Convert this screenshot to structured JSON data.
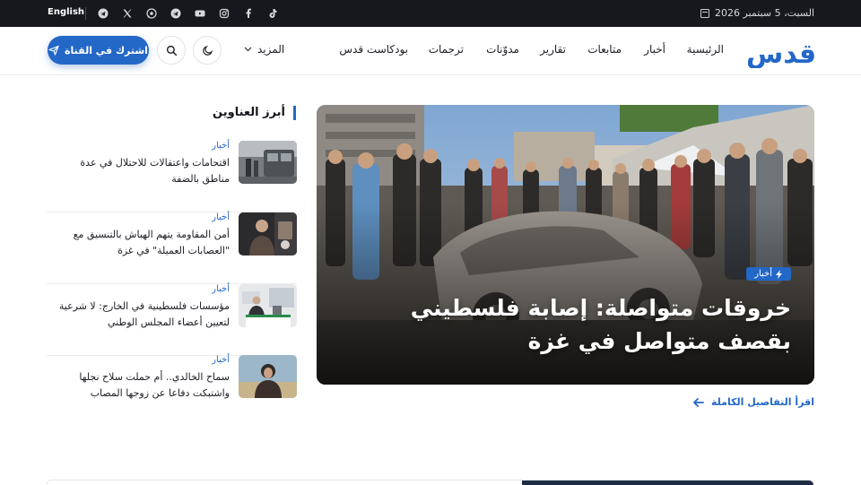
{
  "topbar": {
    "date": "السبت، 5 سبتمبر 2026",
    "language_link": "English",
    "social_icons": [
      "tiktok-icon",
      "facebook-icon",
      "instagram-icon",
      "youtube-icon",
      "telegram-icon",
      "whatsapp-icon",
      "x-icon",
      "telegram-icon"
    ]
  },
  "navbar": {
    "logo_text": "قدس",
    "items": [
      "الرئيسية",
      "أخبار",
      "متابعات",
      "تقارير",
      "مدوّنات",
      "ترجمات",
      "بودكاست قدس"
    ],
    "more_label": "المزيد",
    "subscribe_label": "اشترك في القناة"
  },
  "headlines": {
    "section_title": "أبرز العناوين",
    "items": [
      {
        "category": "أخبار",
        "title": "اقتحامات واعتقالات للاحتلال في عدة مناطق بالضفة"
      },
      {
        "category": "أخبار",
        "title": "أمن المقاومة يتهم الهباش بالتنسيق مع \"العصابات العميلة\" في غزة"
      },
      {
        "category": "أخبار",
        "title": "مؤسسات فلسطينية في الخارج: لا شرعية لتعيين أعضاء المجلس الوطني"
      },
      {
        "category": "أخبار",
        "title": "سماح الخالدي.. أم حملت سلاح نجلها واشتبكت دفاعا عن زوجها المصاب"
      }
    ]
  },
  "hero": {
    "category": "أخبار",
    "title": "خروقات متواصلة: إصابة فلسطيني بقصف متواصل في غزة",
    "read_more": "اقرأ التفاصيل الكاملة"
  },
  "colors": {
    "accent": "#2367c7",
    "topbar_bg": "#16181d",
    "text": "#1a1c22"
  }
}
